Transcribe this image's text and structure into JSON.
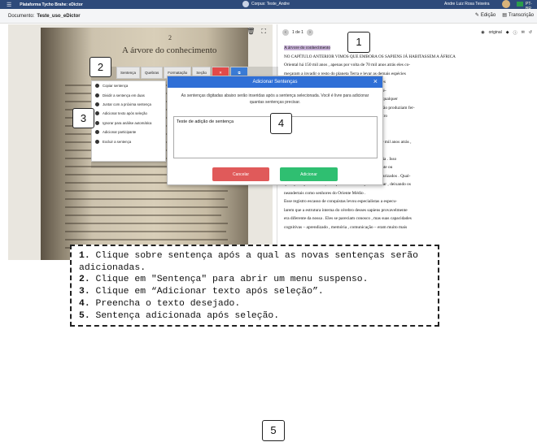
{
  "topbar": {
    "menu_icon": "hamburger-icon",
    "app_name": "Plataforma Tycho Brahe: eDictor",
    "corpus": "Corpus: Teste_Andre",
    "user": "Andre Luiz Rosa Teixeira",
    "lang": "PT-BR"
  },
  "docbar": {
    "label": "Documento:",
    "name": "Teste_uso_eDictor",
    "tab_edit": "Edição",
    "tab_transcription": "Transcrição"
  },
  "left_panel": {
    "page_number": "2",
    "page_title": "A árvore do conhecimento"
  },
  "right_panel": {
    "page_indicator": "1 de 1",
    "original_label": "original",
    "highlight_text": "A árvore do conhecimento",
    "lines": [
      "NO CAPÍTULO ANTERIOR VIMOS QUE EMBORA OS SAPIENS JÁ HABITASSEM A ÁFRICA",
      "Oriental há 150 mil anos , apenas por volta de 70 mil anos atrás eles co-",
      "meçaram a invadir o resto do planeta Terra e levar as demais espécies",
      "humanas à extinção. Nos milênios que se seguiram , esses",
      "sapiens arcaicos eram parecidos conosco e embora seu cé-",
      "rebro fosse grande como o nosso , eles não gozavam de qualquer",
      "vantagem marcante sobre as outras espécies humanas , não produziam fer-",
      "ramentas muito elaboradas e não realizavam nenhum outro",
      "feito especial.",
      "Tal como os confrontos entre sapiens e neandertais ,",
      "algum grupo de sapiens deixou a África por volta de 100 mil anos atrás ,",
      "e se estabeleceu no Levante , que era território",
      "neandertal , mas não conseguiu garantir sua sobrevivência . Isso",
      "pode ter se devido a nativos fortes , a um clima inclemente ou",
      "à presença de parasitas com os quais não estavam familiarizados . Qual-",
      "quer que seja o motivo , os sapiens acabaram por se retirar , deixando os",
      "neandertais como senhores do Oriente Médio .",
      "Esse registro escasso de conquistas levou especialistas a especu-",
      "larem que a estrutura interna do cérebro desses sapiens provavelmente",
      "era diferente da nossa . Eles se pareciam conosco , mas suas capacidades",
      "cognitivas – aprendizado , memória , comunicação – eram muito mais"
    ]
  },
  "toolbar": {
    "sentence": "Sentença",
    "breaks": "Quebras",
    "formatting": "Formatação",
    "section": "Seção"
  },
  "dropdown": {
    "items": [
      "Copiar sentença",
      "Dividir a sentença em duas",
      "Juntar com a próxima sentença",
      "Adicionar texto após seleção",
      "Ignorar para análise automática",
      "Adicionar participante",
      "Excluir a sentença"
    ]
  },
  "modal": {
    "title": "Adicionar Sentenças",
    "description": "As sentenças digitadas abaixo serão inseridas após a sentença selecionada. Você é livre para adicionar quantas sentenças precisar.",
    "textarea_value": "Teste de adição de sentença",
    "cancel": "Cancelar",
    "add": "Adicionar"
  },
  "callouts": [
    "1",
    "2",
    "3",
    "4",
    "5"
  ],
  "instructions": [
    {
      "n": "1.",
      "text": " Clique sobre sentença após a qual as novas sentenças serão adicionadas."
    },
    {
      "n": "2.",
      "text": " Clique em \"Sentença\" para abrir um menu suspenso."
    },
    {
      "n": "3.",
      "text": " Clique em “Adicionar texto após seleção”."
    },
    {
      "n": "4.",
      "text": " Preencha o texto desejado."
    },
    {
      "n": "5.",
      "text": " Sentença adicionada após seleção."
    }
  ]
}
